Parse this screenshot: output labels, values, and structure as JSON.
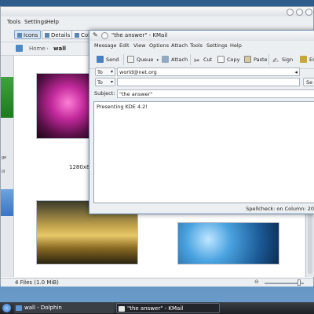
{
  "dolphin": {
    "menus": [
      "Tools",
      "Settings",
      "Help"
    ],
    "view_buttons": [
      {
        "label": "Icons",
        "active": true
      },
      {
        "label": "Details",
        "active": false
      },
      {
        "label": "Col",
        "active": false
      }
    ],
    "breadcrumb": {
      "home": "Home",
      "separator": "›",
      "folder": "wall"
    },
    "places": {
      "label_1": "ge",
      "label_2": "ill"
    },
    "files": [
      {
        "caption": ""
      },
      {
        "caption": "1280x800"
      },
      {
        "caption": ""
      },
      {
        "caption": ""
      }
    ],
    "status": "4 Files (1.0 MiB)"
  },
  "kmail": {
    "title": "\"the answer\" - KMail",
    "menus": [
      "Message",
      "Edit",
      "View",
      "Options",
      "Attach",
      "Tools",
      "Settings",
      "Help"
    ],
    "toolbar": [
      {
        "label": "Send",
        "icon": "send-icon"
      },
      {
        "label": "Queue",
        "icon": "queue-icon"
      },
      {
        "label": "Attach",
        "icon": "attach-icon"
      },
      {
        "label": "Cut",
        "icon": "cut-icon"
      },
      {
        "label": "Copy",
        "icon": "copy-icon"
      },
      {
        "label": "Paste",
        "icon": "paste-icon"
      },
      {
        "label": "Sign",
        "icon": "sign-icon"
      },
      {
        "label": "En",
        "icon": "encrypt-icon"
      }
    ],
    "recipients": [
      {
        "type": "To",
        "value": "world@net.org"
      },
      {
        "type": "To",
        "value": ""
      }
    ],
    "send_button_partial": "Se",
    "subject_label": "Subject:",
    "subject": "\"the answer\"",
    "body": "Presenting KDE 4.2!",
    "status": "Spellcheck: on   Column: 20"
  },
  "taskbar": {
    "tasks": [
      {
        "label": "wall - Dolphin",
        "active": false
      },
      {
        "label": "\"the answer\" - KMail",
        "active": true
      }
    ]
  }
}
